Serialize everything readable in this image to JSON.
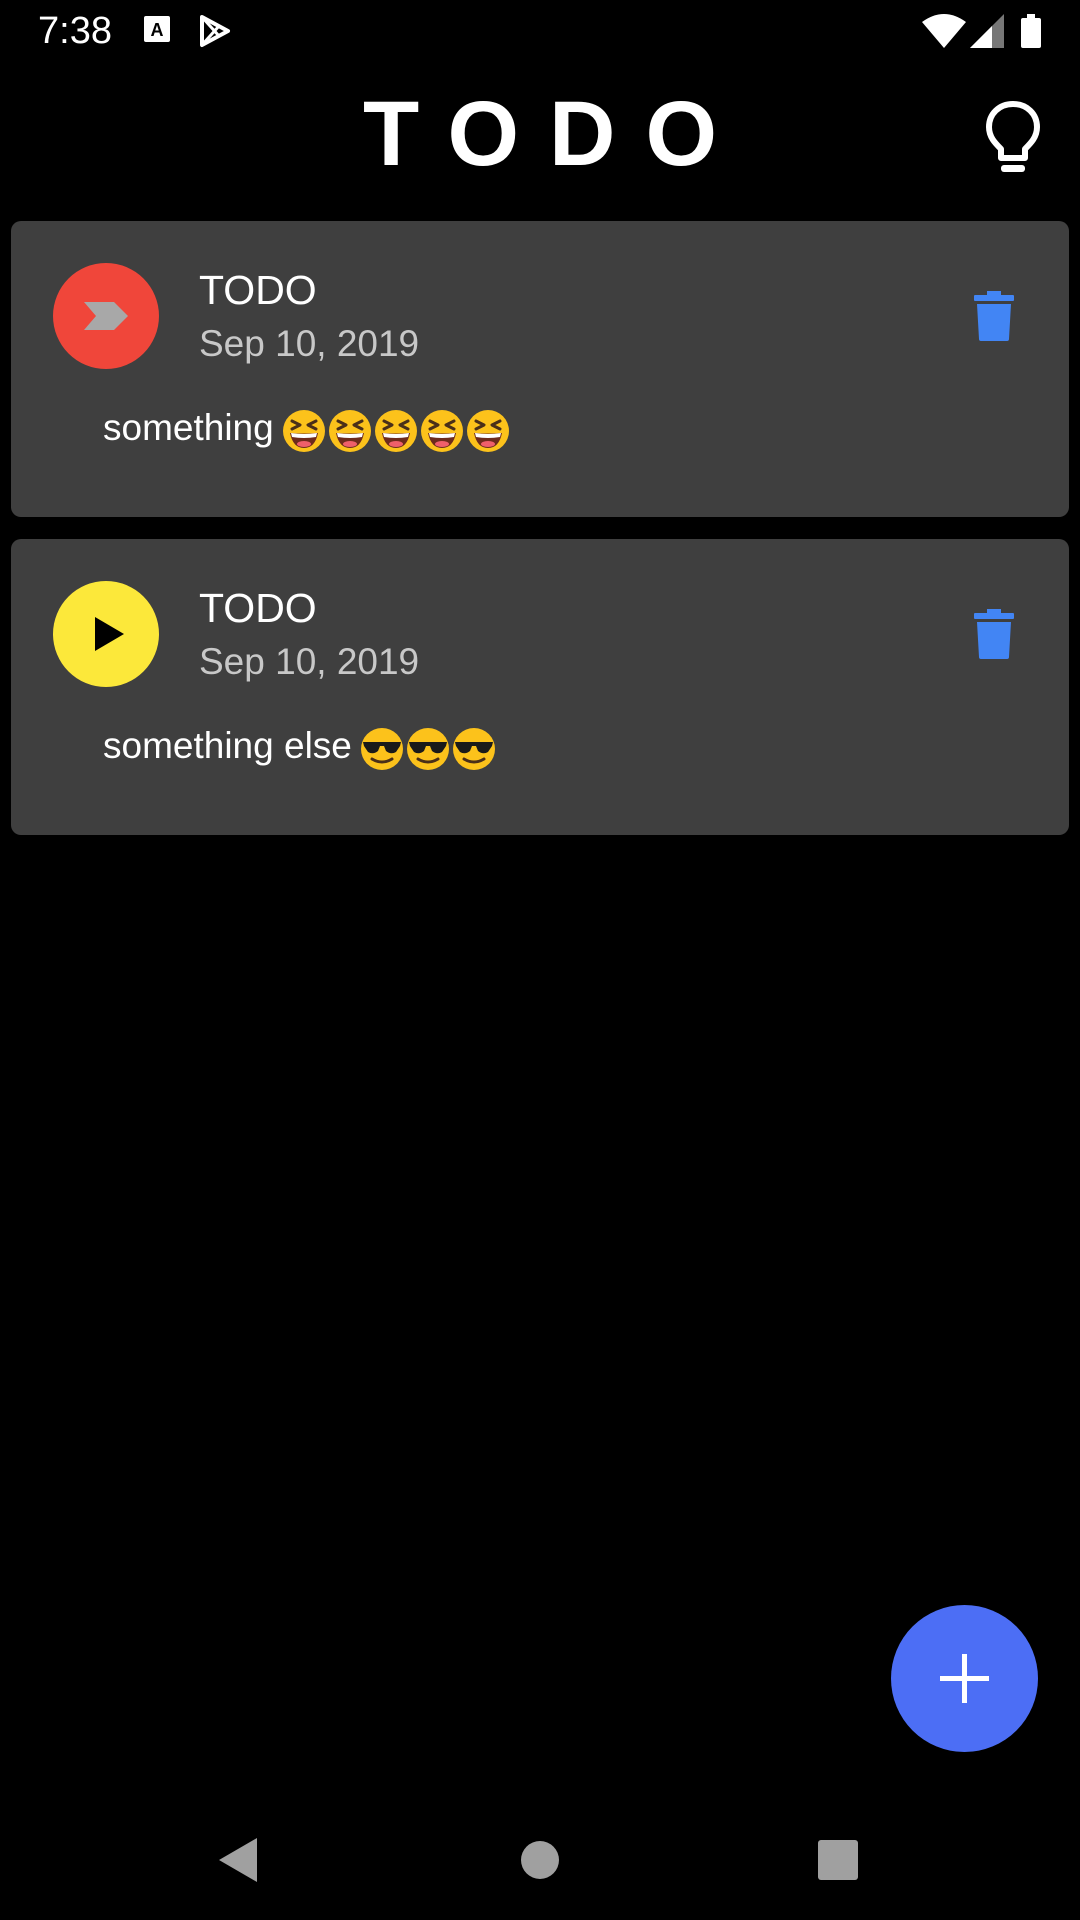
{
  "status_bar": {
    "time": "7:38",
    "icons": [
      "font-download-icon",
      "play-store-icon",
      "wifi-icon",
      "signal-icon",
      "battery-icon"
    ]
  },
  "app": {
    "title": "TODO",
    "theme_toggle_icon": "lightbulb-icon"
  },
  "todos": [
    {
      "status_icon": "chevron-right-icon",
      "status_color": "#f0463a",
      "title": "TODO",
      "date": "Sep 10, 2019",
      "body": "something",
      "emoji": [
        "grinning-squinting-face",
        "grinning-squinting-face",
        "grinning-squinting-face",
        "grinning-squinting-face",
        "grinning-squinting-face"
      ],
      "delete_icon": "trash-icon"
    },
    {
      "status_icon": "play-icon",
      "status_color": "#fce83a",
      "title": "TODO",
      "date": "Sep 10, 2019",
      "body": "something else",
      "emoji": [
        "sunglasses-face",
        "sunglasses-face",
        "sunglasses-face"
      ],
      "delete_icon": "trash-icon"
    }
  ],
  "fab": {
    "icon": "plus-icon",
    "color": "#4c6ef5"
  },
  "nav_bar": {
    "icons": [
      "back-icon",
      "home-icon",
      "recents-icon"
    ]
  },
  "colors": {
    "background": "#000000",
    "card": "#3f3f3f",
    "delete": "#4285f4",
    "date_text": "#c8c8c8"
  }
}
